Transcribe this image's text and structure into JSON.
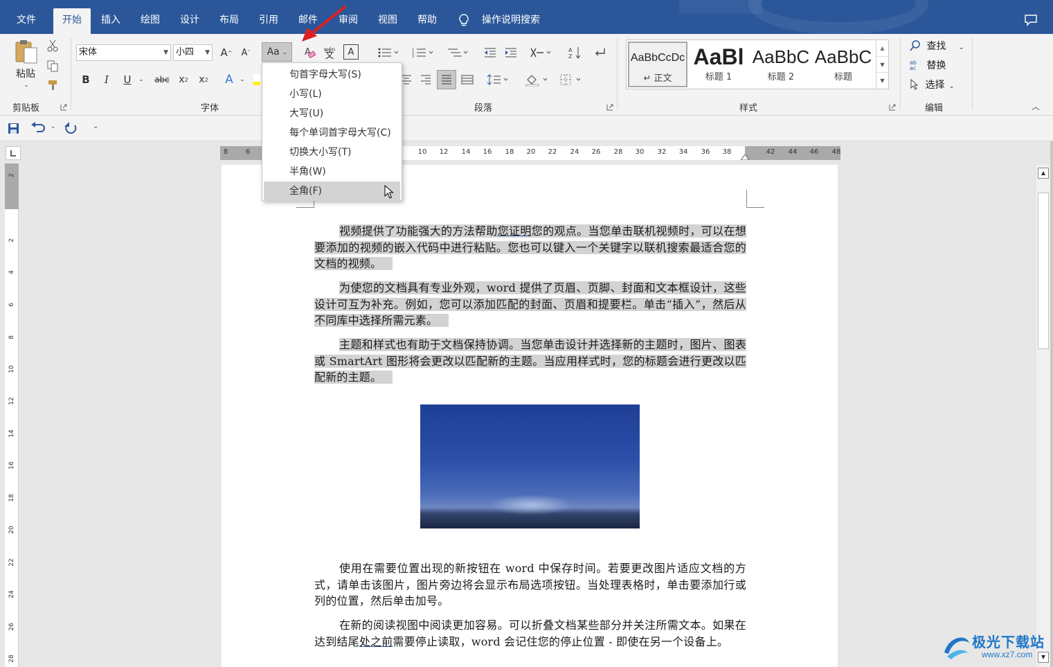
{
  "menubar": {
    "tabs": [
      "文件",
      "开始",
      "插入",
      "绘图",
      "设计",
      "布局",
      "引用",
      "邮件",
      "审阅",
      "视图",
      "帮助"
    ],
    "active_tab": "开始",
    "tell_me": "操作说明搜索"
  },
  "ribbon": {
    "clipboard": {
      "paste": "粘贴",
      "label": "剪贴板"
    },
    "font": {
      "font_name": "宋体",
      "font_size": "小四",
      "grow": "A",
      "shrink": "A",
      "change_case": "Aa",
      "phonetic": "wén",
      "bold": "B",
      "italic": "I",
      "underline": "U",
      "strike": "abc",
      "sub": "x",
      "sup": "x",
      "sub_mark": "2",
      "sup_mark": "2",
      "effects": "A",
      "char_border": "A",
      "label": "字体"
    },
    "paragraph": {
      "label": "段落"
    },
    "styles": {
      "items": [
        {
          "preview": "AaBbCcDc",
          "name": "↵ 正文"
        },
        {
          "preview": "AaBl",
          "name": "标题 1"
        },
        {
          "preview": "AaBbC",
          "name": "标题 2"
        },
        {
          "preview": "AaBbC",
          "name": "标题"
        }
      ],
      "label": "样式"
    },
    "editing": {
      "find": "查找",
      "replace": "替换",
      "select": "选择",
      "replace_badge": "ab ac",
      "label": "编辑"
    }
  },
  "case_menu": {
    "items": [
      "句首字母大写(S)",
      "小写(L)",
      "大写(U)",
      "每个单词首字母大写(C)",
      "切换大小写(T)",
      "半角(W)",
      "全角(F)"
    ],
    "hovered": "全角(F)"
  },
  "ruler": {
    "h_numbers": [
      "8",
      "6",
      "10",
      "12",
      "14",
      "16",
      "18",
      "20",
      "22",
      "24",
      "26",
      "28",
      "30",
      "32",
      "34",
      "36",
      "38",
      "42",
      "44",
      "46",
      "48"
    ],
    "v_numbers": [
      "2",
      "2",
      "4",
      "6",
      "8",
      "10",
      "12",
      "14",
      "16",
      "18",
      "20",
      "22",
      "24",
      "26",
      "28"
    ]
  },
  "document": {
    "p1": {
      "a": "视频提供了功能强大的方法帮助",
      "link": "您证明",
      "b": "您的观点。当您单击联机视频时，可以在想要添加的视频的嵌入代码中进行粘贴。您也可以键入一个关键字以联机搜索最适合您的文档的视频。"
    },
    "p2": "为使您的文档具有专业外观，word 提供了页眉、页脚、封面和文本框设计，这些设计可互为补充。例如，您可以添加匹配的封面、页眉和提要栏。单击“插入”，然后从不同库中选择所需元素。",
    "p3": "主题和样式也有助于文档保持协调。当您单击设计并选择新的主题时，图片、图表或 SmartArt 图形将会更改以匹配新的主题。当应用样式时，您的标题会进行更改以匹配新的主题。",
    "p4": "使用在需要位置出现的新按钮在 word 中保存时间。若要更改图片适应文档的方式，请单击该图片，图片旁边将会显示布局选项按钮。当处理表格时，单击要添加行或列的位置，然后单击加号。",
    "p5": {
      "a": "在新的阅读视图中阅读更加容易。可以折叠文档某些部分并关注所需文本。如果在达到结尾",
      "link": "处之前",
      "b": "需要停止读取，word 会记住您的停止位置 - 即使在另一个设备上。"
    }
  },
  "watermark": {
    "name": "极光下载站",
    "url": "www.xz7.com"
  }
}
